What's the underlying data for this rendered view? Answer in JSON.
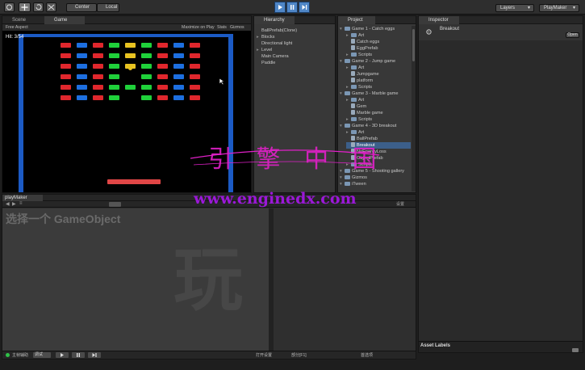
{
  "toolbar": {
    "center_label": "Center",
    "local_label": "Local",
    "layers_label": "Layers",
    "layout_label": "PlayMaker"
  },
  "scene_view": {
    "tabs": [
      {
        "label": "Scene"
      },
      {
        "label": "Game"
      }
    ],
    "aspect_label": "Free Aspect",
    "maximize_label": "Maximize on Play",
    "stats_label": "Stats",
    "gizmos_label": "Gizmos",
    "hits_text": "Hit: 3/54"
  },
  "hierarchy": {
    "title": "Hierarchy",
    "items": [
      {
        "label": "BallPrefab(Clone)",
        "expandable": false
      },
      {
        "label": "Blocks",
        "expandable": true
      },
      {
        "label": "Directional light",
        "expandable": false
      },
      {
        "label": "Level",
        "expandable": true
      },
      {
        "label": "Main Camera",
        "expandable": false
      },
      {
        "label": "Paddle",
        "expandable": false
      }
    ]
  },
  "project": {
    "title": "Project",
    "items": [
      {
        "label": "Game 1 - Catch eggs",
        "kind": "folder",
        "depth": 0
      },
      {
        "label": "Art",
        "kind": "folder",
        "depth": 1
      },
      {
        "label": "Catch eggs",
        "kind": "file",
        "depth": 1
      },
      {
        "label": "EggPrefab",
        "kind": "file",
        "depth": 1
      },
      {
        "label": "Scripts",
        "kind": "folder",
        "depth": 1
      },
      {
        "label": "Game 2 - Jump game",
        "kind": "folder",
        "depth": 0
      },
      {
        "label": "Art",
        "kind": "folder",
        "depth": 1
      },
      {
        "label": "Jumpgame",
        "kind": "file",
        "depth": 1
      },
      {
        "label": "platform",
        "kind": "file",
        "depth": 1
      },
      {
        "label": "Scripts",
        "kind": "folder",
        "depth": 1
      },
      {
        "label": "Game 3 - Marble game",
        "kind": "folder",
        "depth": 0
      },
      {
        "label": "Art",
        "kind": "folder",
        "depth": 1
      },
      {
        "label": "Gem",
        "kind": "file",
        "depth": 1
      },
      {
        "label": "Marble game",
        "kind": "file",
        "depth": 1
      },
      {
        "label": "Scripts",
        "kind": "folder",
        "depth": 1
      },
      {
        "label": "Game 4 - 3D breakout",
        "kind": "folder",
        "depth": 0
      },
      {
        "label": "Art",
        "kind": "folder",
        "depth": 1
      },
      {
        "label": "BallPrefab",
        "kind": "file",
        "depth": 1
      },
      {
        "label": "Breakout",
        "kind": "file",
        "depth": 1
      },
      {
        "label": "NoEnergyLoss",
        "kind": "file",
        "depth": 1
      },
      {
        "label": "ObjectPrefab",
        "kind": "file",
        "depth": 1
      },
      {
        "label": "Scripts",
        "kind": "folder",
        "depth": 1
      },
      {
        "label": "Game 5 - Shooting gallery",
        "kind": "folder",
        "depth": 0
      },
      {
        "label": "Gizmos",
        "kind": "folder",
        "depth": 0
      },
      {
        "label": "iTween",
        "kind": "folder",
        "depth": 0
      }
    ]
  },
  "inspector": {
    "title": "Inspector",
    "object_name": "Breakout",
    "open_label": "Open",
    "asset_labels": "Asset Labels"
  },
  "playmaker": {
    "title": "playMaker",
    "select_prompt": "选择一个 GameObject",
    "bottom_labels": {
      "left": "主帧辅助",
      "mode": "调试",
      "center": "打开设置",
      "right1": "部分[F1]",
      "right2": "首选项"
    },
    "right_header": "设置"
  },
  "watermark": {
    "chars": "引 擎 中 国",
    "url": "www.enginedx.com",
    "big_char": "玩"
  },
  "colors": {
    "brick_red": "#e0272d",
    "brick_blue": "#1d6fe0",
    "brick_green": "#1fd13a",
    "brick_yellow": "#e8c321",
    "paddle": "#e04646",
    "game_border": "#1b5ac4",
    "watermark_pink": "#e020c8",
    "watermark_purple": "#9b18d8"
  }
}
